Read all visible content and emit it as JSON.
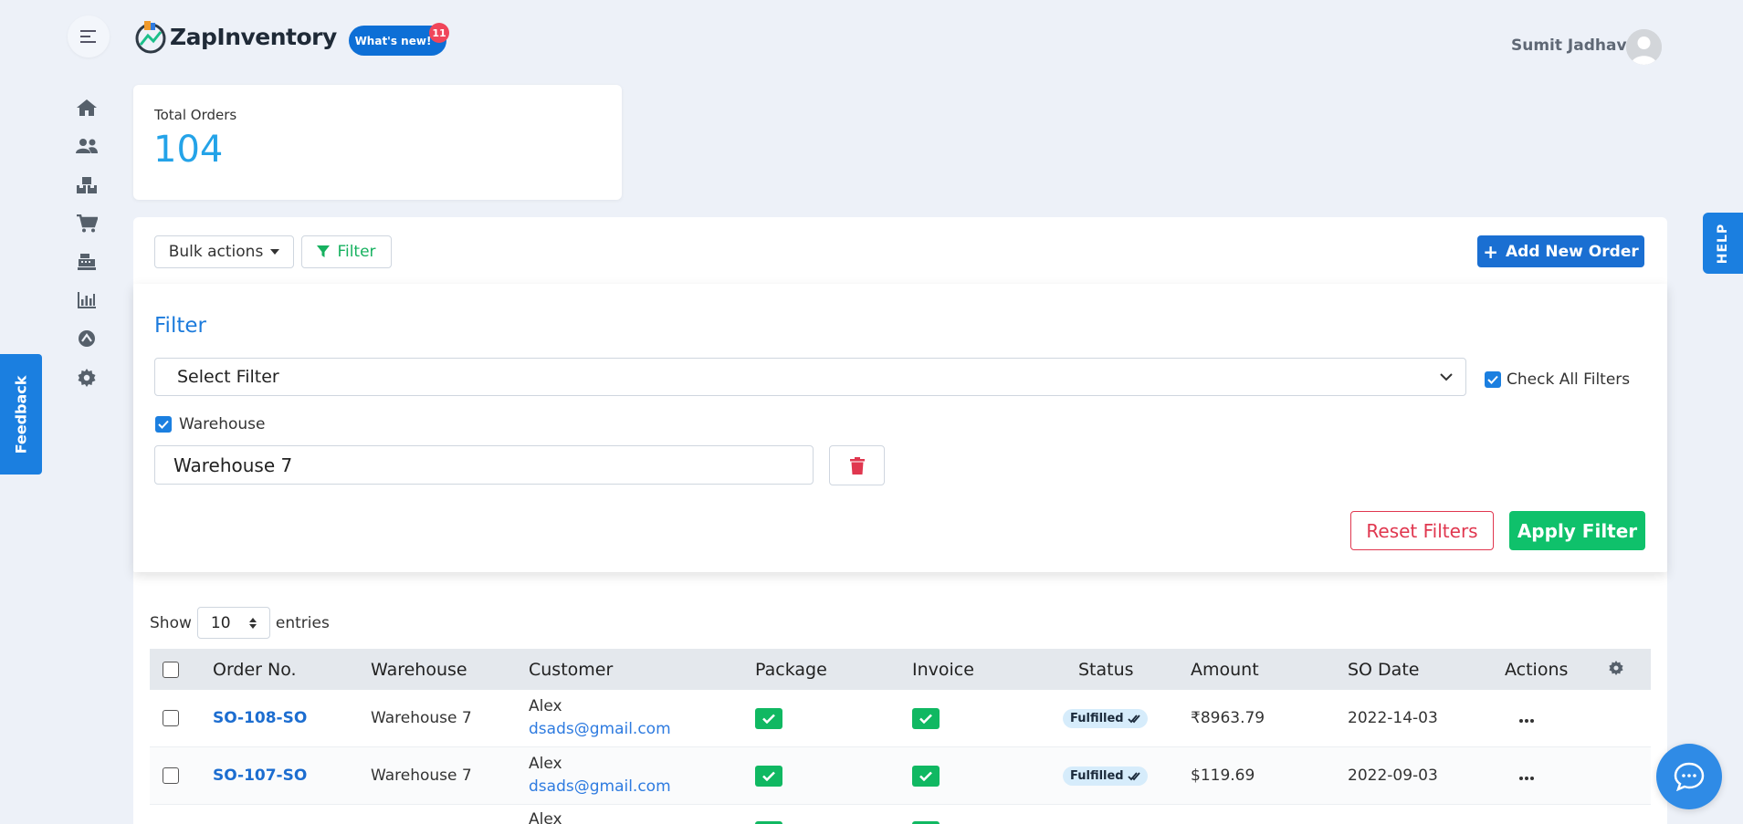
{
  "header": {
    "brand": "ZapInventory",
    "whats_new_label": "What's new!",
    "whats_new_count": "11",
    "user_name": "Sumit Jadhav"
  },
  "sidebar": {
    "items": [
      {
        "icon": "home-icon"
      },
      {
        "icon": "users-icon"
      },
      {
        "icon": "boxes-icon"
      },
      {
        "icon": "cart-icon"
      },
      {
        "icon": "cash-register-icon"
      },
      {
        "icon": "chart-icon"
      },
      {
        "icon": "integrations-icon"
      },
      {
        "icon": "gear-icon"
      }
    ]
  },
  "feedback_label": "Feedback",
  "help_label": "HELP",
  "stats": {
    "label": "Total Orders",
    "value": "104"
  },
  "toolbar": {
    "bulk_label": "Bulk actions",
    "filter_label": "Filter",
    "add_label": "Add New Order"
  },
  "filter_panel": {
    "title": "Filter",
    "select_placeholder": "Select Filter",
    "check_all_label": "Check All Filters",
    "warehouse_label": "Warehouse",
    "warehouse_value": "Warehouse 7",
    "reset_label": "Reset Filters",
    "apply_label": "Apply Filter"
  },
  "entries": {
    "show_label": "Show",
    "value": "10",
    "suffix": "entries"
  },
  "table": {
    "headers": [
      "Order No.",
      "Warehouse",
      "Customer",
      "Package",
      "Invoice",
      "Status",
      "Amount",
      "SO Date",
      "Actions"
    ],
    "rows": [
      {
        "order": "SO-108-SO",
        "warehouse": "Warehouse 7",
        "customer": "Alex",
        "email": "dsads@gmail.com",
        "status": "Fulfilled",
        "amount": "₹8963.79",
        "date": "2022-14-03"
      },
      {
        "order": "SO-107-SO",
        "warehouse": "Warehouse 7",
        "customer": "Alex",
        "email": "dsads@gmail.com",
        "status": "Fulfilled",
        "amount": "$119.69",
        "date": "2022-09-03"
      },
      {
        "order": "",
        "warehouse": "",
        "customer": "Alex",
        "email": "",
        "status": "",
        "amount": "",
        "date": ""
      }
    ]
  },
  "colors": {
    "primary": "#1a6fd2",
    "success": "#0fc16b",
    "danger": "#e0374f",
    "stat": "#24a3e8"
  }
}
